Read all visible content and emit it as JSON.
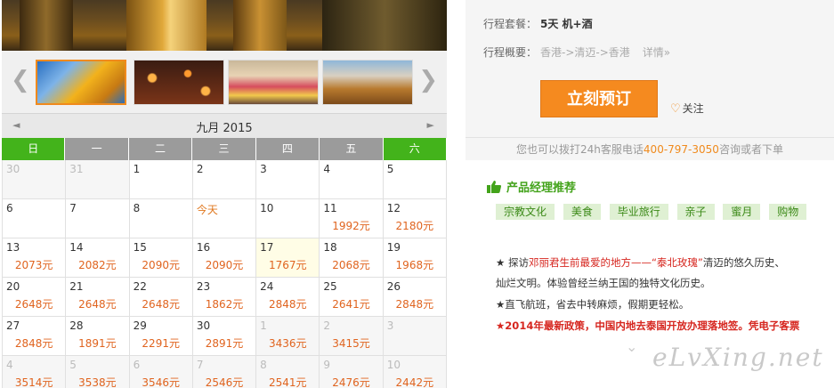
{
  "gallery": {
    "prev_icon": "chevron-left-icon",
    "next_icon": "chevron-right-icon",
    "prev_glyph": "❮",
    "next_glyph": "❯"
  },
  "calendar": {
    "title": "九月 2015",
    "prev_glyph": "◄",
    "next_glyph": "►",
    "weekdays": [
      "日",
      "一",
      "二",
      "三",
      "四",
      "五",
      "六"
    ],
    "weeks": [
      [
        {
          "d": "30",
          "p": "",
          "m": true
        },
        {
          "d": "31",
          "p": "",
          "m": true
        },
        {
          "d": "1",
          "p": ""
        },
        {
          "d": "2",
          "p": ""
        },
        {
          "d": "3",
          "p": ""
        },
        {
          "d": "4",
          "p": ""
        },
        {
          "d": "5",
          "p": ""
        }
      ],
      [
        {
          "d": "6",
          "p": ""
        },
        {
          "d": "7",
          "p": ""
        },
        {
          "d": "8",
          "p": ""
        },
        {
          "d": "今天",
          "p": "",
          "today": true
        },
        {
          "d": "10",
          "p": ""
        },
        {
          "d": "11",
          "p": "1992元"
        },
        {
          "d": "12",
          "p": "2180元"
        }
      ],
      [
        {
          "d": "13",
          "p": "2073元"
        },
        {
          "d": "14",
          "p": "2082元"
        },
        {
          "d": "15",
          "p": "2090元"
        },
        {
          "d": "16",
          "p": "2090元"
        },
        {
          "d": "17",
          "p": "1767元",
          "hl": true
        },
        {
          "d": "18",
          "p": "2068元"
        },
        {
          "d": "19",
          "p": "1968元"
        }
      ],
      [
        {
          "d": "20",
          "p": "2648元"
        },
        {
          "d": "21",
          "p": "2648元"
        },
        {
          "d": "22",
          "p": "2648元"
        },
        {
          "d": "23",
          "p": "1862元"
        },
        {
          "d": "24",
          "p": "2848元"
        },
        {
          "d": "25",
          "p": "2641元"
        },
        {
          "d": "26",
          "p": "2848元"
        }
      ],
      [
        {
          "d": "27",
          "p": "2848元"
        },
        {
          "d": "28",
          "p": "1891元"
        },
        {
          "d": "29",
          "p": "2291元"
        },
        {
          "d": "30",
          "p": "2891元"
        },
        {
          "d": "1",
          "p": "3436元",
          "m": true
        },
        {
          "d": "2",
          "p": "3415元",
          "m": true
        },
        {
          "d": "3",
          "p": "",
          "m": true
        }
      ],
      [
        {
          "d": "4",
          "p": "3514元",
          "m": true
        },
        {
          "d": "5",
          "p": "3538元",
          "m": true
        },
        {
          "d": "6",
          "p": "3546元",
          "m": true
        },
        {
          "d": "7",
          "p": "2546元",
          "m": true
        },
        {
          "d": "8",
          "p": "2541元",
          "m": true
        },
        {
          "d": "9",
          "p": "2476元",
          "m": true
        },
        {
          "d": "10",
          "p": "2442元",
          "m": true
        }
      ]
    ]
  },
  "info": {
    "package_label": "行程套餐：",
    "package_value": "5天  机+酒",
    "route_label": "行程概要：",
    "route_value": "香港->清迈->香港",
    "detail_link": "详情»",
    "book_button": "立刻预订",
    "follow_label": "关注",
    "hotline_prefix": "您也可以拨打24h客服电话",
    "hotline_phone": "400-797-3050",
    "hotline_suffix": "咨询或者下单"
  },
  "recommend": {
    "title": "产品经理推荐",
    "tags": [
      "宗教文化",
      "美食",
      "毕业旅行",
      "亲子",
      "蜜月",
      "购物"
    ],
    "line1_a": "★ 探访",
    "line1_b": "邓丽君生前最爱的地方——“泰北玫瑰”",
    "line1_c": "清迈的悠久历史、",
    "line2": "灿烂文明。体验曾经兰纳王国的独特文化历史。",
    "line3": "★直飞航班，省去中转麻烦，假期更轻松。",
    "line4": "★2014年最新政策，中国内地去泰国开放办理落地签。凭电子客票",
    "more_glyph": "⌄"
  },
  "watermark": "eLvXing.net",
  "colors": {
    "accent_orange": "#f58a1f",
    "weekend_green": "#43b31b",
    "price_orange": "#e0641f",
    "tag_bg": "#dff0d3"
  }
}
